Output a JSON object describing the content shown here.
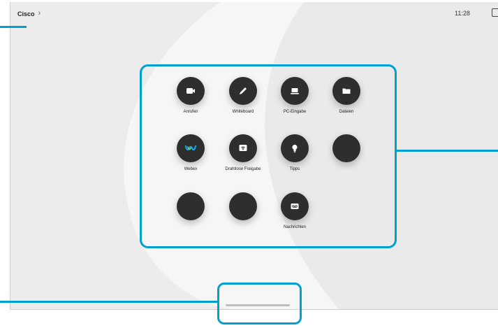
{
  "header": {
    "title": "Cisco",
    "chevron": "›",
    "time": "11:28"
  },
  "apps": [
    {
      "label": "Anrufen",
      "icon": "video-camera-icon"
    },
    {
      "label": "Whiteboard",
      "icon": "pencil-icon"
    },
    {
      "label": "PC-Eingabe",
      "icon": "laptop-icon"
    },
    {
      "label": "Dateien",
      "icon": "folder-icon"
    },
    {
      "label": "Webex",
      "icon": "webex-icon"
    },
    {
      "label": "Drahtlose Freigabe",
      "icon": "wireless-share-icon"
    },
    {
      "label": "Tipps",
      "icon": "lightbulb-icon"
    },
    {
      "label": "",
      "icon": "blank-app-icon"
    },
    {
      "label": "",
      "icon": "blank-app-icon"
    },
    {
      "label": "",
      "icon": "blank-app-icon"
    },
    {
      "label": "Nachrichten",
      "icon": "voicemail-icon"
    }
  ],
  "colors": {
    "callout": "#00a0d1",
    "button": "#2e2e2e",
    "background": "#ececec"
  }
}
